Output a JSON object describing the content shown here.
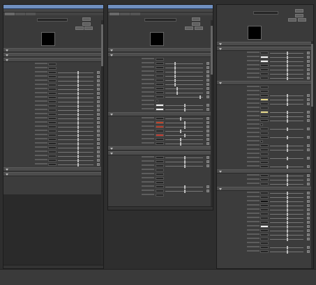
{
  "windows": [
    {
      "title": "",
      "menu": [
        "",
        "",
        "",
        "",
        ""
      ],
      "tabs": [
        "",
        "",
        ""
      ],
      "name_label": "",
      "name_value": "",
      "buttons": [
        "",
        "",
        "",
        ""
      ],
      "sections": [
        {
          "label": ""
        },
        {
          "label": ""
        },
        {
          "label": "",
          "rows": [
            {
              "label": "",
              "kind": "field"
            },
            {
              "label": "",
              "kind": "field"
            },
            {
              "label": "",
              "kind": "slider",
              "value": 0.55
            },
            {
              "label": "",
              "kind": "slider",
              "value": 0.55
            },
            {
              "label": "",
              "kind": "slider",
              "value": 0.55
            },
            {
              "label": "",
              "kind": "slider",
              "value": 0.55
            },
            {
              "label": "",
              "kind": "slider",
              "value": 0.55
            },
            {
              "label": "",
              "kind": "slider",
              "value": 0.55
            },
            {
              "label": "",
              "kind": "slider",
              "value": 0.55
            },
            {
              "label": "",
              "kind": "slider",
              "value": 0.55
            },
            {
              "label": "",
              "kind": "slider",
              "value": 0.55
            },
            {
              "label": "",
              "kind": "slider",
              "value": 0.55
            },
            {
              "label": "",
              "kind": "slider",
              "value": 0.55
            },
            {
              "label": "",
              "kind": "slider",
              "value": 0.55
            },
            {
              "label": "",
              "kind": "slider",
              "value": 0.55
            },
            {
              "label": "",
              "kind": "slider",
              "value": 0.55
            },
            {
              "label": "",
              "kind": "slider",
              "value": 0.55
            },
            {
              "label": "",
              "kind": "slider",
              "value": 0.55
            },
            {
              "label": "",
              "kind": "slider",
              "value": 0.55
            },
            {
              "label": "",
              "kind": "slider",
              "value": 0.55
            },
            {
              "label": "",
              "kind": "slider",
              "value": 0.55
            },
            {
              "label": "",
              "kind": "slider",
              "value": 0.55
            },
            {
              "label": "",
              "kind": "slider",
              "value": 0.55
            },
            {
              "label": "",
              "kind": "slider",
              "value": 0.55
            },
            {
              "label": "",
              "kind": "slider",
              "value": 0.55
            }
          ]
        },
        {
          "label": ""
        },
        {
          "label": ""
        }
      ],
      "status": ""
    },
    {
      "title": "",
      "menu": [
        "",
        "",
        "",
        "",
        ""
      ],
      "tabs": [
        "",
        "",
        ""
      ],
      "name_label": "",
      "name_value": "",
      "buttons": [
        "",
        "",
        "",
        ""
      ],
      "sections": [
        {
          "label": ""
        },
        {
          "label": "",
          "rows": [
            {
              "label": "",
              "kind": "field"
            },
            {
              "label": "",
              "kind": "slider",
              "value": 0.25
            },
            {
              "label": "",
              "kind": "slider",
              "value": 0.25
            },
            {
              "label": "",
              "kind": "slider",
              "value": 0.25
            },
            {
              "label": "",
              "kind": "slider",
              "value": 0.25
            },
            {
              "label": "",
              "kind": "slider",
              "value": 0.25
            },
            {
              "label": "",
              "kind": "slider",
              "value": 0.25
            },
            {
              "label": "",
              "kind": "slider",
              "value": 0.3
            },
            {
              "label": "",
              "kind": "slider",
              "value": 0.3
            },
            {
              "label": "",
              "kind": "slider",
              "value": 0.9
            },
            {
              "label": "",
              "kind": "checkbox"
            },
            {
              "label": "",
              "kind": "color",
              "color": "#f2f2f2"
            },
            {
              "label": "",
              "kind": "color",
              "color": "#f2f2f2"
            }
          ]
        },
        {
          "label": "",
          "rows": [
            {
              "label": "",
              "kind": "slider",
              "value": 0.4
            },
            {
              "label": "",
              "kind": "color",
              "color": "#c0452a"
            },
            {
              "label": "",
              "kind": "color",
              "color": "#b53b27"
            },
            {
              "label": "",
              "kind": "slider",
              "value": 0.4
            },
            {
              "label": "",
              "kind": "color",
              "color": "#c23a2e"
            },
            {
              "label": "",
              "kind": "slider",
              "value": 0.4
            },
            {
              "label": "",
              "kind": "slider",
              "value": 0.4
            }
          ]
        },
        {
          "label": ""
        },
        {
          "label": "",
          "rows": [
            {
              "label": "",
              "kind": "slider",
              "value": 0.5
            },
            {
              "label": "",
              "kind": "slider",
              "value": 0.5
            },
            {
              "label": "",
              "kind": "slider",
              "value": 0.5
            },
            {
              "label": "",
              "kind": "field"
            },
            {
              "label": "",
              "kind": "field"
            },
            {
              "label": "",
              "kind": "field"
            },
            {
              "label": "",
              "kind": "field"
            },
            {
              "label": "",
              "kind": "slider",
              "value": 0.5
            },
            {
              "label": "",
              "kind": "slider",
              "value": 0.5
            },
            {
              "label": "",
              "kind": "field"
            }
          ]
        }
      ],
      "status": ""
    },
    {
      "title": "",
      "menu": [],
      "tabs": [],
      "name_label": "",
      "name_value": "",
      "buttons": [
        "",
        "",
        "",
        ""
      ],
      "sections": [
        {
          "label": ""
        },
        {
          "label": "",
          "rows": [
            {
              "label": "",
              "kind": "slider",
              "value": 0.5
            },
            {
              "label": "",
              "kind": "color",
              "color": "#f2f2f2"
            },
            {
              "label": "",
              "kind": "color",
              "color": "#f2f2f2"
            },
            {
              "label": "",
              "kind": "slider",
              "value": 0.5
            },
            {
              "label": "",
              "kind": "slider",
              "value": 0.5
            },
            {
              "label": "",
              "kind": "slider",
              "value": 0.5
            },
            {
              "label": "",
              "kind": "slider",
              "value": 0.5
            }
          ]
        },
        {
          "label": "",
          "rows": [
            {
              "label": "",
              "kind": "field"
            },
            {
              "label": "",
              "kind": "field"
            },
            {
              "label": "",
              "kind": "slider",
              "value": 0.5
            },
            {
              "label": "",
              "kind": "color",
              "color": "#e6d98a"
            },
            {
              "label": "",
              "kind": "slider",
              "value": 0.5
            },
            {
              "label": "",
              "kind": "field"
            },
            {
              "label": "",
              "kind": "color",
              "color": "#e6d98a"
            },
            {
              "label": "",
              "kind": "slider",
              "value": 0.5
            },
            {
              "label": "",
              "kind": "slider",
              "value": 0.5
            },
            {
              "label": "",
              "kind": "checkbox"
            },
            {
              "label": "",
              "kind": "slider",
              "value": 0.5
            },
            {
              "label": "",
              "kind": "field"
            },
            {
              "label": "",
              "kind": "slider",
              "value": 0.5
            },
            {
              "label": "",
              "kind": "checkbox"
            },
            {
              "label": "",
              "kind": "slider",
              "value": 0.5
            },
            {
              "label": "",
              "kind": "slider",
              "value": 0.5
            },
            {
              "label": "",
              "kind": "field"
            },
            {
              "label": "",
              "kind": "slider",
              "value": 0.5
            },
            {
              "label": "",
              "kind": "field"
            },
            {
              "label": "",
              "kind": "slider",
              "value": 0.5
            }
          ]
        },
        {
          "label": "",
          "rows": [
            {
              "label": "",
              "kind": "slider",
              "value": 0.5
            },
            {
              "label": "",
              "kind": "slider",
              "value": 0.5
            },
            {
              "label": "",
              "kind": "slider",
              "value": 0.5
            }
          ]
        },
        {
          "label": "",
          "rows": [
            {
              "label": "",
              "kind": "slider",
              "value": 0.5
            },
            {
              "label": "",
              "kind": "slider",
              "value": 0.5
            },
            {
              "label": "",
              "kind": "color",
              "color": "#111111"
            },
            {
              "label": "",
              "kind": "slider",
              "value": 0.5
            },
            {
              "label": "",
              "kind": "slider",
              "value": 0.5
            },
            {
              "label": "",
              "kind": "slider",
              "value": 0.5
            },
            {
              "label": "",
              "kind": "slider",
              "value": 0.5
            },
            {
              "label": "",
              "kind": "slider",
              "value": 0.5
            },
            {
              "label": "",
              "kind": "color",
              "color": "#f2f2f2"
            },
            {
              "label": "",
              "kind": "slider",
              "value": 0.5
            },
            {
              "label": "",
              "kind": "slider",
              "value": 0.5
            },
            {
              "label": "",
              "kind": "slider",
              "value": 0.5
            },
            {
              "label": "",
              "kind": "field"
            },
            {
              "label": "",
              "kind": "slider",
              "value": 0.5
            },
            {
              "label": "",
              "kind": "slider",
              "value": 0.5
            }
          ]
        }
      ],
      "status": ""
    }
  ]
}
